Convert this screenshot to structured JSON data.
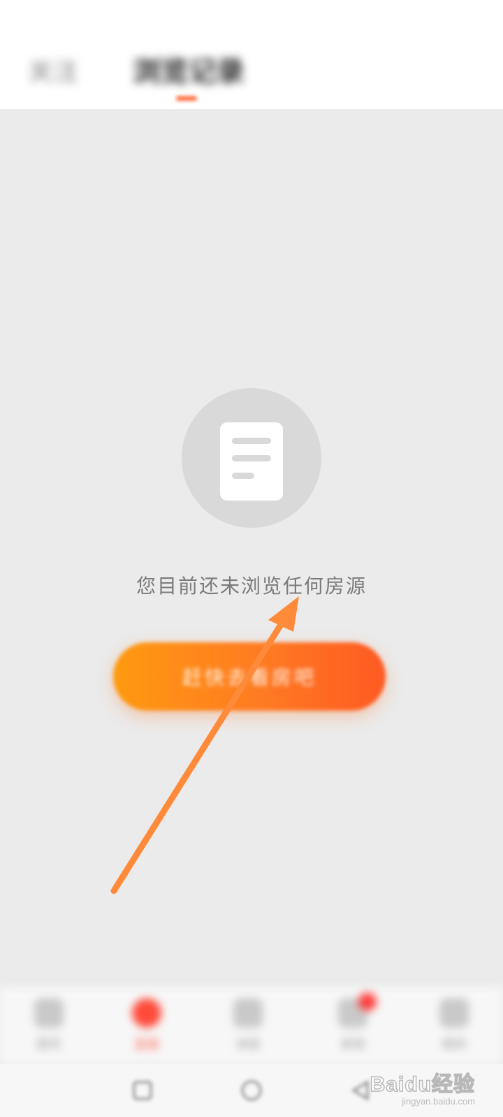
{
  "status_bar": {
    "time": "",
    "indicators": ""
  },
  "header": {
    "tabs": [
      {
        "label": "关注"
      },
      {
        "label": "浏览记录"
      }
    ],
    "active_tab": 1,
    "accent_color": "#ff5722"
  },
  "empty_state": {
    "icon": "document-icon",
    "message": "您目前还未浏览任何房源",
    "cta_label": "赶快去看房吧",
    "cta_gradient": [
      "#ff9a10",
      "#ff5a22"
    ]
  },
  "annotation": {
    "icon": "arrow-icon",
    "color": "#ff8a3a"
  },
  "bottom_nav": {
    "items": [
      {
        "label": "首页",
        "icon": "home-icon"
      },
      {
        "label": "足迹",
        "icon": "heart-icon"
      },
      {
        "label": "消息",
        "icon": "message-icon"
      },
      {
        "label": "发现",
        "icon": "discover-icon"
      },
      {
        "label": "我的",
        "icon": "profile-icon"
      }
    ],
    "active_index": 1
  },
  "watermark": {
    "logo": "Baidu经验",
    "url": "jingyan.baidu.com"
  }
}
